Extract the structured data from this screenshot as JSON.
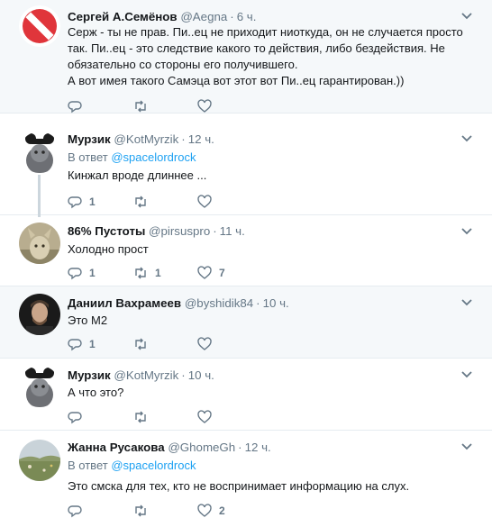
{
  "tweets": [
    {
      "name": "Сергей А.Семёнов",
      "handle": "@Aegna",
      "time": "6 ч.",
      "avatar_icon": "red-stop-sign-avatar",
      "text": "Серж - ты не прав. Пи..ец не приходит ниоткуда, он не случается просто так. Пи..ец - это следствие какого то действия, либо бездействия. Не обязательно со стороны его получившего.\nА вот имея такого Самэца вот этот вот Пи..ец гарантирован.))",
      "reply_count": "",
      "retweet_count": "",
      "like_count": ""
    },
    {
      "name": "Мурзик",
      "handle": "@KotMyrzik",
      "time": "12 ч.",
      "avatar_icon": "cat-avatar",
      "reply_prefix": "В ответ",
      "reply_to": "@spacelordrock",
      "text": "Кинжал вроде длиннее ...",
      "reply_count": "1",
      "retweet_count": "",
      "like_count": ""
    },
    {
      "name": "86% Пустоты",
      "handle": "@pirsuspro",
      "time": "11 ч.",
      "avatar_icon": "animal-avatar",
      "text": "Холодно прост",
      "reply_count": "1",
      "retweet_count": "1",
      "like_count": "7"
    },
    {
      "name": "Даниил Вахрамеев",
      "handle": "@byshidik84",
      "time": "10 ч.",
      "avatar_icon": "man-portrait-avatar",
      "text": "Это М2",
      "reply_count": "1",
      "retweet_count": "",
      "like_count": ""
    },
    {
      "name": "Мурзик",
      "handle": "@KotMyrzik",
      "time": "10 ч.",
      "avatar_icon": "cat-avatar",
      "text": "А что это?",
      "reply_count": "",
      "retweet_count": "",
      "like_count": ""
    },
    {
      "name": "Жанна Русакова",
      "handle": "@GhomeGh",
      "time": "12 ч.",
      "avatar_icon": "landscape-avatar",
      "reply_prefix": "В ответ",
      "reply_to": "@spacelordrock",
      "text": "Это смска для тех, кто не воспринимает информацию на слух.",
      "reply_count": "",
      "retweet_count": "",
      "like_count": "2"
    }
  ],
  "icons": {
    "reply": "reply-icon",
    "retweet": "retweet-icon",
    "like": "heart-icon",
    "more": "chevron-down-icon"
  },
  "colors": {
    "link": "#1da1f2",
    "muted": "#657786",
    "shaded_bg": "#f5f8fa",
    "thread_line": "#ccd6dd"
  }
}
